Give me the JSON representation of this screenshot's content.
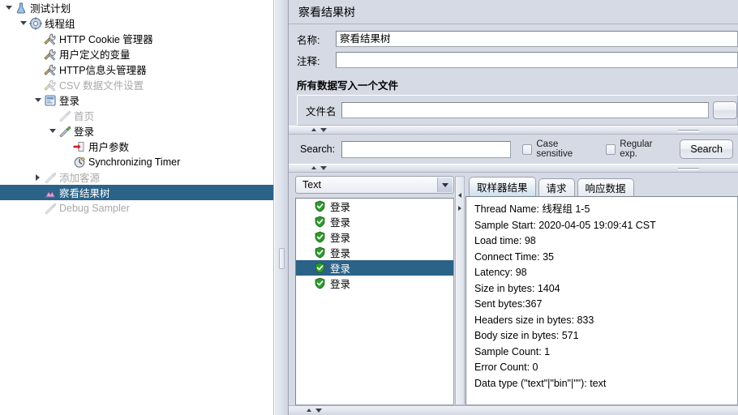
{
  "tree": {
    "items": [
      {
        "label": "测试计划",
        "depth": 0,
        "toggle": "open",
        "icon": "flask-icon",
        "disabled": false,
        "selected": false
      },
      {
        "label": "线程组",
        "depth": 1,
        "toggle": "open",
        "icon": "gear-icon",
        "disabled": false,
        "selected": false
      },
      {
        "label": "HTTP Cookie 管理器",
        "depth": 2,
        "toggle": "none",
        "icon": "wrench-icon",
        "disabled": false,
        "selected": false
      },
      {
        "label": "用户定义的变量",
        "depth": 2,
        "toggle": "none",
        "icon": "wrench-icon",
        "disabled": false,
        "selected": false
      },
      {
        "label": "HTTP信息头管理器",
        "depth": 2,
        "toggle": "none",
        "icon": "wrench-icon",
        "disabled": false,
        "selected": false
      },
      {
        "label": "CSV 数据文件设置",
        "depth": 2,
        "toggle": "none",
        "icon": "wrench-icon",
        "disabled": true,
        "selected": false
      },
      {
        "label": "登录",
        "depth": 2,
        "toggle": "open",
        "icon": "controller-icon",
        "disabled": false,
        "selected": false
      },
      {
        "label": "首页",
        "depth": 3,
        "toggle": "none",
        "icon": "sampler-icon",
        "disabled": true,
        "selected": false
      },
      {
        "label": "登录",
        "depth": 3,
        "toggle": "open",
        "icon": "sampler-icon",
        "disabled": false,
        "selected": false
      },
      {
        "label": "用户参数",
        "depth": 4,
        "toggle": "none",
        "icon": "preprocessor-icon",
        "disabled": false,
        "selected": false
      },
      {
        "label": "Synchronizing Timer",
        "depth": 4,
        "toggle": "none",
        "icon": "timer-icon",
        "disabled": false,
        "selected": false
      },
      {
        "label": "添加客源",
        "depth": 2,
        "toggle": "closed",
        "icon": "sampler-icon",
        "disabled": true,
        "selected": false
      },
      {
        "label": "察看结果树",
        "depth": 2,
        "toggle": "none",
        "icon": "listener-icon",
        "disabled": false,
        "selected": true
      },
      {
        "label": "Debug Sampler",
        "depth": 2,
        "toggle": "none",
        "icon": "sampler-icon",
        "disabled": true,
        "selected": false
      }
    ]
  },
  "panel": {
    "title": "察看结果树",
    "name_label": "名称:",
    "name_value": "察看结果树",
    "comment_label": "注释:",
    "comment_value": "",
    "file_group_title": "所有数据写入一个文件",
    "filename_label": "文件名",
    "filename_value": "",
    "browse_label": ""
  },
  "search": {
    "label": "Search:",
    "value": "",
    "case_sensitive_label": "Case sensitive",
    "regular_exp_label": "Regular exp.",
    "button_label": "Search"
  },
  "results": {
    "renderer_selected": "Text",
    "items": [
      {
        "label": "登录",
        "status": "success",
        "selected": false
      },
      {
        "label": "登录",
        "status": "success",
        "selected": false
      },
      {
        "label": "登录",
        "status": "success",
        "selected": false
      },
      {
        "label": "登录",
        "status": "success",
        "selected": false
      },
      {
        "label": "登录",
        "status": "success",
        "selected": true
      },
      {
        "label": "登录",
        "status": "success",
        "selected": false
      }
    ],
    "tabs": [
      {
        "label": "取样器结果",
        "active": true
      },
      {
        "label": "请求",
        "active": false
      },
      {
        "label": "响应数据",
        "active": false
      }
    ],
    "detail_lines": [
      "Thread Name: 线程组 1-5",
      "Sample Start: 2020-04-05 19:09:41 CST",
      "Load time: 98",
      "Connect Time: 35",
      "Latency: 98",
      "Size in bytes: 1404",
      "Sent bytes:367",
      "Headers size in bytes: 833",
      "Body size in bytes: 571",
      "Sample Count: 1",
      "Error Count: 0",
      "Data type (\"text\"|\"bin\"|\"\"): text"
    ]
  },
  "colors": {
    "selection": "#2b6288",
    "panel_bg": "#d6dae4",
    "success": "#2f9b2f"
  }
}
